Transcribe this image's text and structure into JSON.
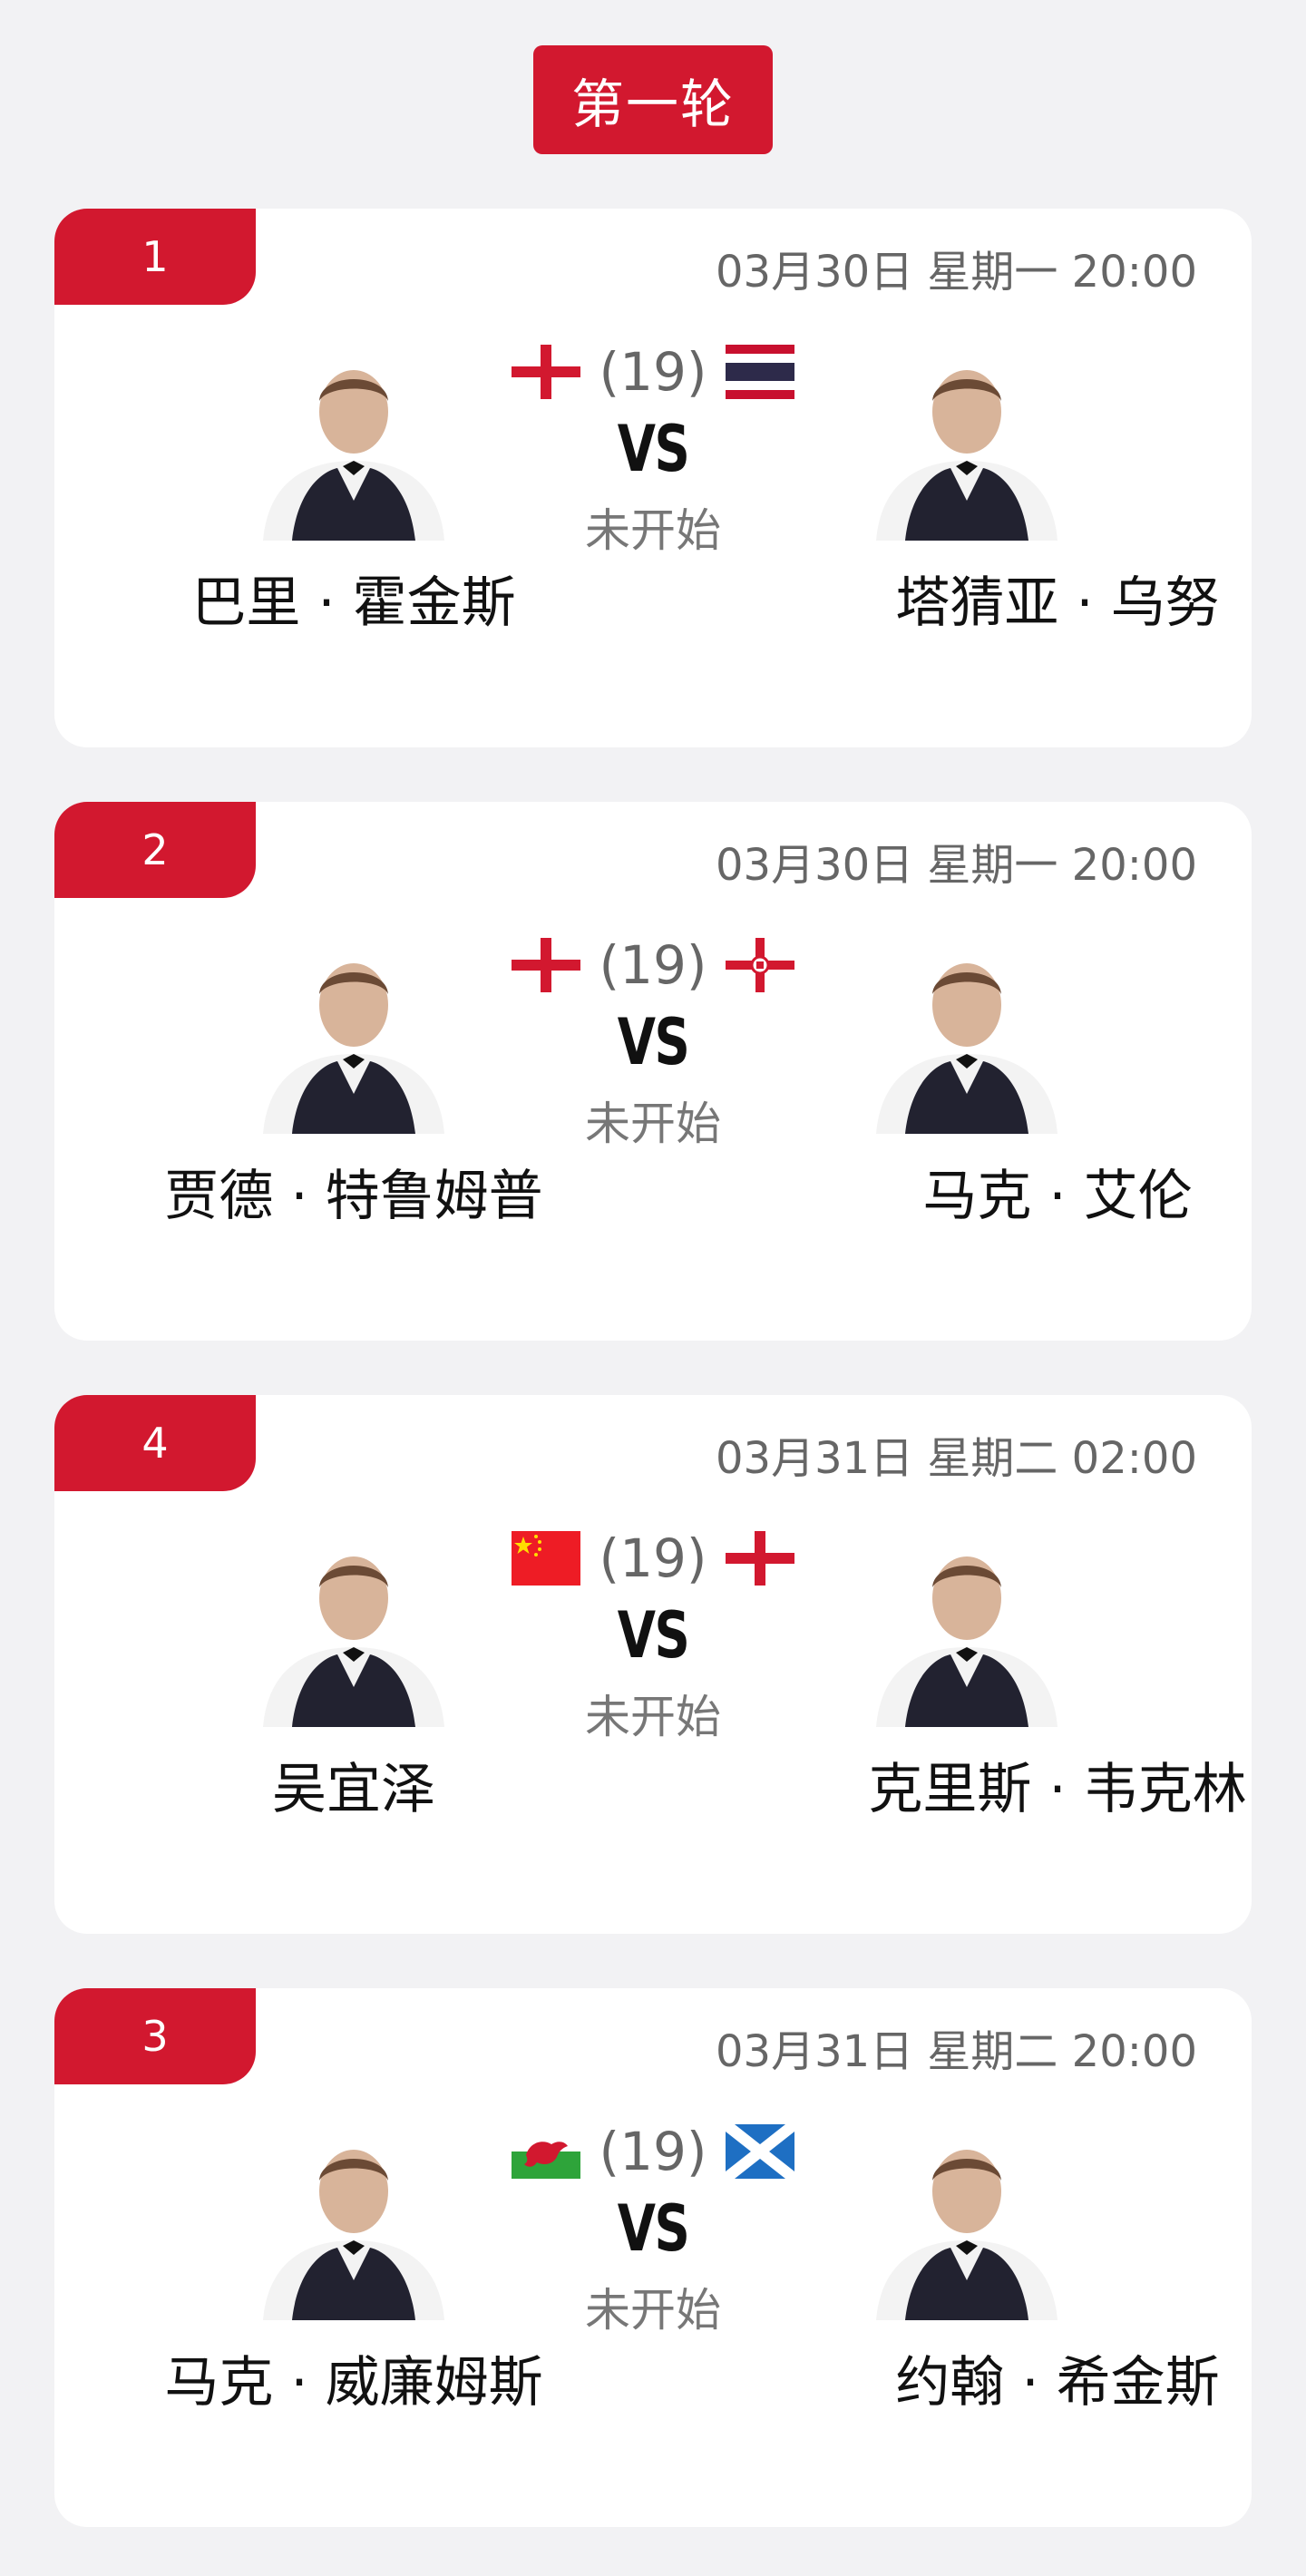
{
  "round": {
    "title": "第一轮"
  },
  "matches": [
    {
      "number": "1",
      "time": "03月30日 星期一 20:00",
      "left_player": {
        "name": "巴里 · 霍金斯",
        "flag": "england-flag"
      },
      "right_player": {
        "name": "塔猜亚 · 乌努",
        "flag": "thailand-flag"
      },
      "seed": "(19)",
      "vs": "VS",
      "status": "未开始"
    },
    {
      "number": "2",
      "time": "03月30日 星期一 20:00",
      "left_player": {
        "name": "贾德 · 特鲁姆普",
        "flag": "england-flag"
      },
      "right_player": {
        "name": "马克 · 艾伦",
        "flag": "northern-ireland-flag"
      },
      "seed": "(19)",
      "vs": "VS",
      "status": "未开始"
    },
    {
      "number": "4",
      "time": "03月31日 星期二 02:00",
      "left_player": {
        "name": "吴宜泽",
        "flag": "china-flag"
      },
      "right_player": {
        "name": "克里斯 · 韦克林",
        "flag": "england-flag"
      },
      "seed": "(19)",
      "vs": "VS",
      "status": "未开始"
    },
    {
      "number": "3",
      "time": "03月31日 星期二 20:00",
      "left_player": {
        "name": "马克 · 威廉姆斯",
        "flag": "wales-flag"
      },
      "right_player": {
        "name": "约翰 · 希金斯",
        "flag": "scotland-flag"
      },
      "seed": "(19)",
      "vs": "VS",
      "status": "未开始"
    }
  ],
  "colors": {
    "accent": "#d2182f",
    "background": "#f2f2f4",
    "card": "#ffffff",
    "muted_text": "#666666",
    "name_text": "#111111"
  }
}
